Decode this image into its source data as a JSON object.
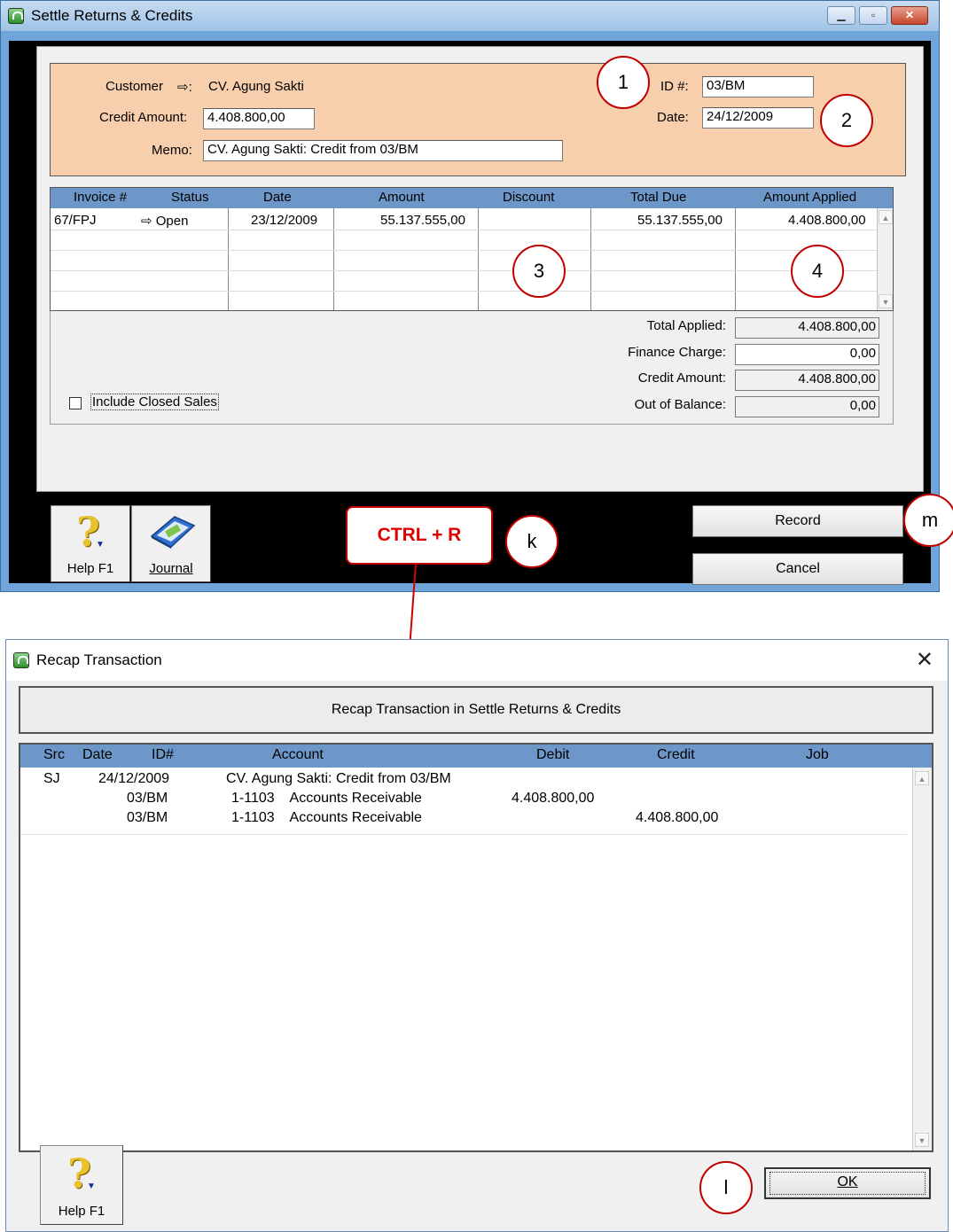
{
  "window1": {
    "title": "Settle Returns & Credits",
    "customer_label": "Customer",
    "customer_arrow": "⇨:",
    "customer_value": "CV. Agung Sakti",
    "credit_amount_label": "Credit Amount:",
    "credit_amount_value": "4.408.800,00",
    "memo_label": "Memo:",
    "memo_value": "CV. Agung Sakti:  Credit from 03/BM",
    "id_label": "ID #:",
    "id_value": "03/BM",
    "date_label": "Date:",
    "date_value": "24/12/2009",
    "grid": {
      "headers": [
        "Invoice #",
        "Status",
        "Date",
        "Amount",
        "Discount",
        "Total Due",
        "Amount Applied"
      ],
      "row": {
        "invoice": "67/FPJ",
        "status": "⇨ Open",
        "date": "23/12/2009",
        "amount": "55.137.555,00",
        "discount": "",
        "total_due": "55.137.555,00",
        "amount_applied": "4.408.800,00"
      }
    },
    "totals": {
      "total_applied_label": "Total Applied:",
      "total_applied_value": "4.408.800,00",
      "finance_charge_label": "Finance Charge:",
      "finance_charge_value": "0,00",
      "credit_amount_label": "Credit Amount:",
      "credit_amount_value": "4.408.800,00",
      "out_of_balance_label": "Out of Balance:",
      "out_of_balance_value": "0,00"
    },
    "include_closed_label": "Include Closed Sales",
    "help_label": "Help F1",
    "journal_label": "Journal",
    "record_label": "Record",
    "cancel_label": "Cancel"
  },
  "annotations": {
    "n1": "1",
    "n2": "2",
    "n3": "3",
    "n4": "4",
    "k": "k",
    "m": "m",
    "l": "l",
    "shortcut": "CTRL + R"
  },
  "window2": {
    "title": "Recap Transaction",
    "close": "✕",
    "banner": "Recap Transaction in Settle Returns & Credits",
    "headers": [
      "Src",
      "Date",
      "ID#",
      "Account",
      "Debit",
      "Credit",
      "Job"
    ],
    "rows": [
      {
        "src": "SJ",
        "date": "24/12/2009",
        "id": "",
        "account": "CV. Agung Sakti:  Credit from 03/BM",
        "debit": "",
        "credit": ""
      },
      {
        "src": "",
        "date": "",
        "id": "03/BM",
        "account": "1-1103    Accounts Receivable",
        "debit": "4.408.800,00",
        "credit": ""
      },
      {
        "src": "",
        "date": "",
        "id": "03/BM",
        "account": "1-1103    Accounts Receivable",
        "debit": "",
        "credit": "4.408.800,00"
      }
    ],
    "help_label": "Help F1",
    "ok_label": "OK"
  },
  "icons": {
    "help": "help-question-icon",
    "journal": "journal-book-icon",
    "app": "app-lock-icon"
  }
}
